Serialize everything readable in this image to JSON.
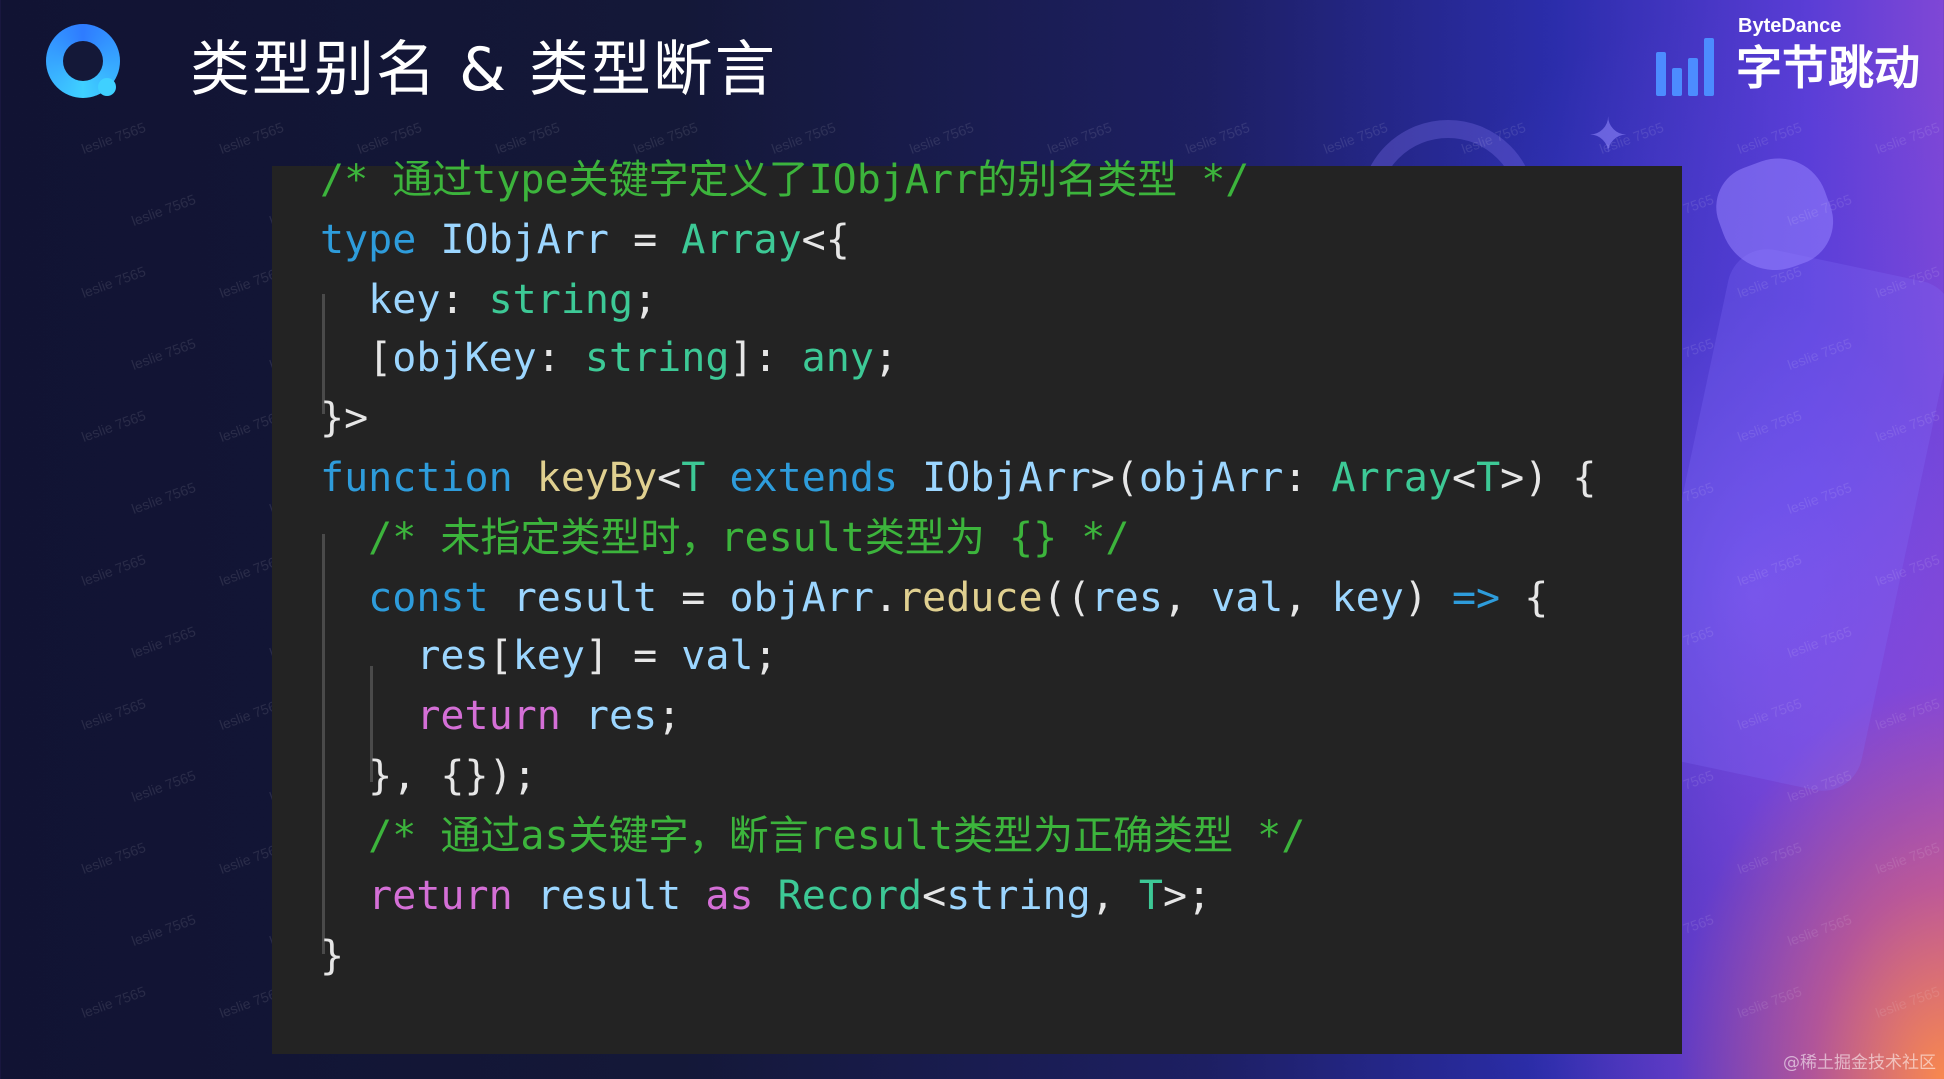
{
  "slide": {
    "title": "类型别名 & 类型断言",
    "app_logo_icon": "q-logo-icon"
  },
  "brand": {
    "english": "ByteDance",
    "chinese": "字节跳动",
    "logo_icon": "bytedance-bars-icon",
    "color": "#4c8cff"
  },
  "code": {
    "lines": [
      [
        {
          "t": "/* 通过type关键字定义了IObjArr的别名类型 */",
          "k": "comment"
        }
      ],
      [
        {
          "t": "type",
          "k": "kw"
        },
        {
          "t": " ",
          "k": "punc"
        },
        {
          "t": "IObjArr",
          "k": "id"
        },
        {
          "t": " = ",
          "k": "punc"
        },
        {
          "t": "Array",
          "k": "type"
        },
        {
          "t": "<{",
          "k": "punc"
        }
      ],
      [
        {
          "t": "  ",
          "k": "punc"
        },
        {
          "t": "key",
          "k": "id"
        },
        {
          "t": ": ",
          "k": "punc"
        },
        {
          "t": "string",
          "k": "type"
        },
        {
          "t": ";",
          "k": "punc"
        }
      ],
      [
        {
          "t": "  [",
          "k": "punc"
        },
        {
          "t": "objKey",
          "k": "id"
        },
        {
          "t": ": ",
          "k": "punc"
        },
        {
          "t": "string",
          "k": "type"
        },
        {
          "t": "]: ",
          "k": "punc"
        },
        {
          "t": "any",
          "k": "type"
        },
        {
          "t": ";",
          "k": "punc"
        }
      ],
      [
        {
          "t": "}>",
          "k": "punc"
        }
      ],
      [
        {
          "t": "function",
          "k": "kw"
        },
        {
          "t": " ",
          "k": "punc"
        },
        {
          "t": "keyBy",
          "k": "func"
        },
        {
          "t": "<",
          "k": "punc"
        },
        {
          "t": "T",
          "k": "type"
        },
        {
          "t": " ",
          "k": "punc"
        },
        {
          "t": "extends",
          "k": "kw"
        },
        {
          "t": " ",
          "k": "punc"
        },
        {
          "t": "IObjArr",
          "k": "id"
        },
        {
          "t": ">(",
          "k": "punc"
        },
        {
          "t": "objArr",
          "k": "id"
        },
        {
          "t": ": ",
          "k": "punc"
        },
        {
          "t": "Array",
          "k": "type"
        },
        {
          "t": "<",
          "k": "punc"
        },
        {
          "t": "T",
          "k": "type"
        },
        {
          "t": ">) {",
          "k": "punc"
        }
      ],
      [
        {
          "t": "  ",
          "k": "punc"
        },
        {
          "t": "/* 未指定类型时，result类型为 {} */",
          "k": "comment"
        }
      ],
      [
        {
          "t": "  ",
          "k": "punc"
        },
        {
          "t": "const",
          "k": "kw"
        },
        {
          "t": " ",
          "k": "punc"
        },
        {
          "t": "result",
          "k": "id"
        },
        {
          "t": " = ",
          "k": "punc"
        },
        {
          "t": "objArr",
          "k": "id"
        },
        {
          "t": ".",
          "k": "punc"
        },
        {
          "t": "reduce",
          "k": "func"
        },
        {
          "t": "((",
          "k": "punc"
        },
        {
          "t": "res",
          "k": "id"
        },
        {
          "t": ", ",
          "k": "punc"
        },
        {
          "t": "val",
          "k": "id"
        },
        {
          "t": ", ",
          "k": "punc"
        },
        {
          "t": "key",
          "k": "id"
        },
        {
          "t": ") ",
          "k": "punc"
        },
        {
          "t": "=>",
          "k": "arrow"
        },
        {
          "t": " {",
          "k": "punc"
        }
      ],
      [
        {
          "t": "    ",
          "k": "punc"
        },
        {
          "t": "res",
          "k": "id"
        },
        {
          "t": "[",
          "k": "punc"
        },
        {
          "t": "key",
          "k": "id"
        },
        {
          "t": "] = ",
          "k": "punc"
        },
        {
          "t": "val",
          "k": "id"
        },
        {
          "t": ";",
          "k": "punc"
        }
      ],
      [
        {
          "t": "    ",
          "k": "punc"
        },
        {
          "t": "return",
          "k": "ret"
        },
        {
          "t": " ",
          "k": "punc"
        },
        {
          "t": "res",
          "k": "id"
        },
        {
          "t": ";",
          "k": "punc"
        }
      ],
      [
        {
          "t": "  }, {});",
          "k": "punc"
        }
      ],
      [
        {
          "t": "  ",
          "k": "punc"
        },
        {
          "t": "/* 通过as关键字，断言result类型为正确类型 */",
          "k": "comment"
        }
      ],
      [
        {
          "t": "  ",
          "k": "punc"
        },
        {
          "t": "return",
          "k": "ret"
        },
        {
          "t": " ",
          "k": "punc"
        },
        {
          "t": "result",
          "k": "id"
        },
        {
          "t": " ",
          "k": "punc"
        },
        {
          "t": "as",
          "k": "ret"
        },
        {
          "t": " ",
          "k": "punc"
        },
        {
          "t": "Record",
          "k": "type"
        },
        {
          "t": "<",
          "k": "punc"
        },
        {
          "t": "string",
          "k": "id"
        },
        {
          "t": ", ",
          "k": "punc"
        },
        {
          "t": "T",
          "k": "type"
        },
        {
          "t": ">;",
          "k": "punc"
        }
      ],
      [
        {
          "t": "}",
          "k": "punc"
        }
      ]
    ]
  },
  "watermark_text": "leslie 7565",
  "footer": "@稀土掘金技术社区",
  "colors": {
    "comment": "#3cb43c",
    "keyword": "#2e9cdb",
    "type": "#3dc996",
    "function": "#e0d090",
    "identifier": "#9cd6ff",
    "return": "#d46fd6",
    "panel": "#232323"
  }
}
